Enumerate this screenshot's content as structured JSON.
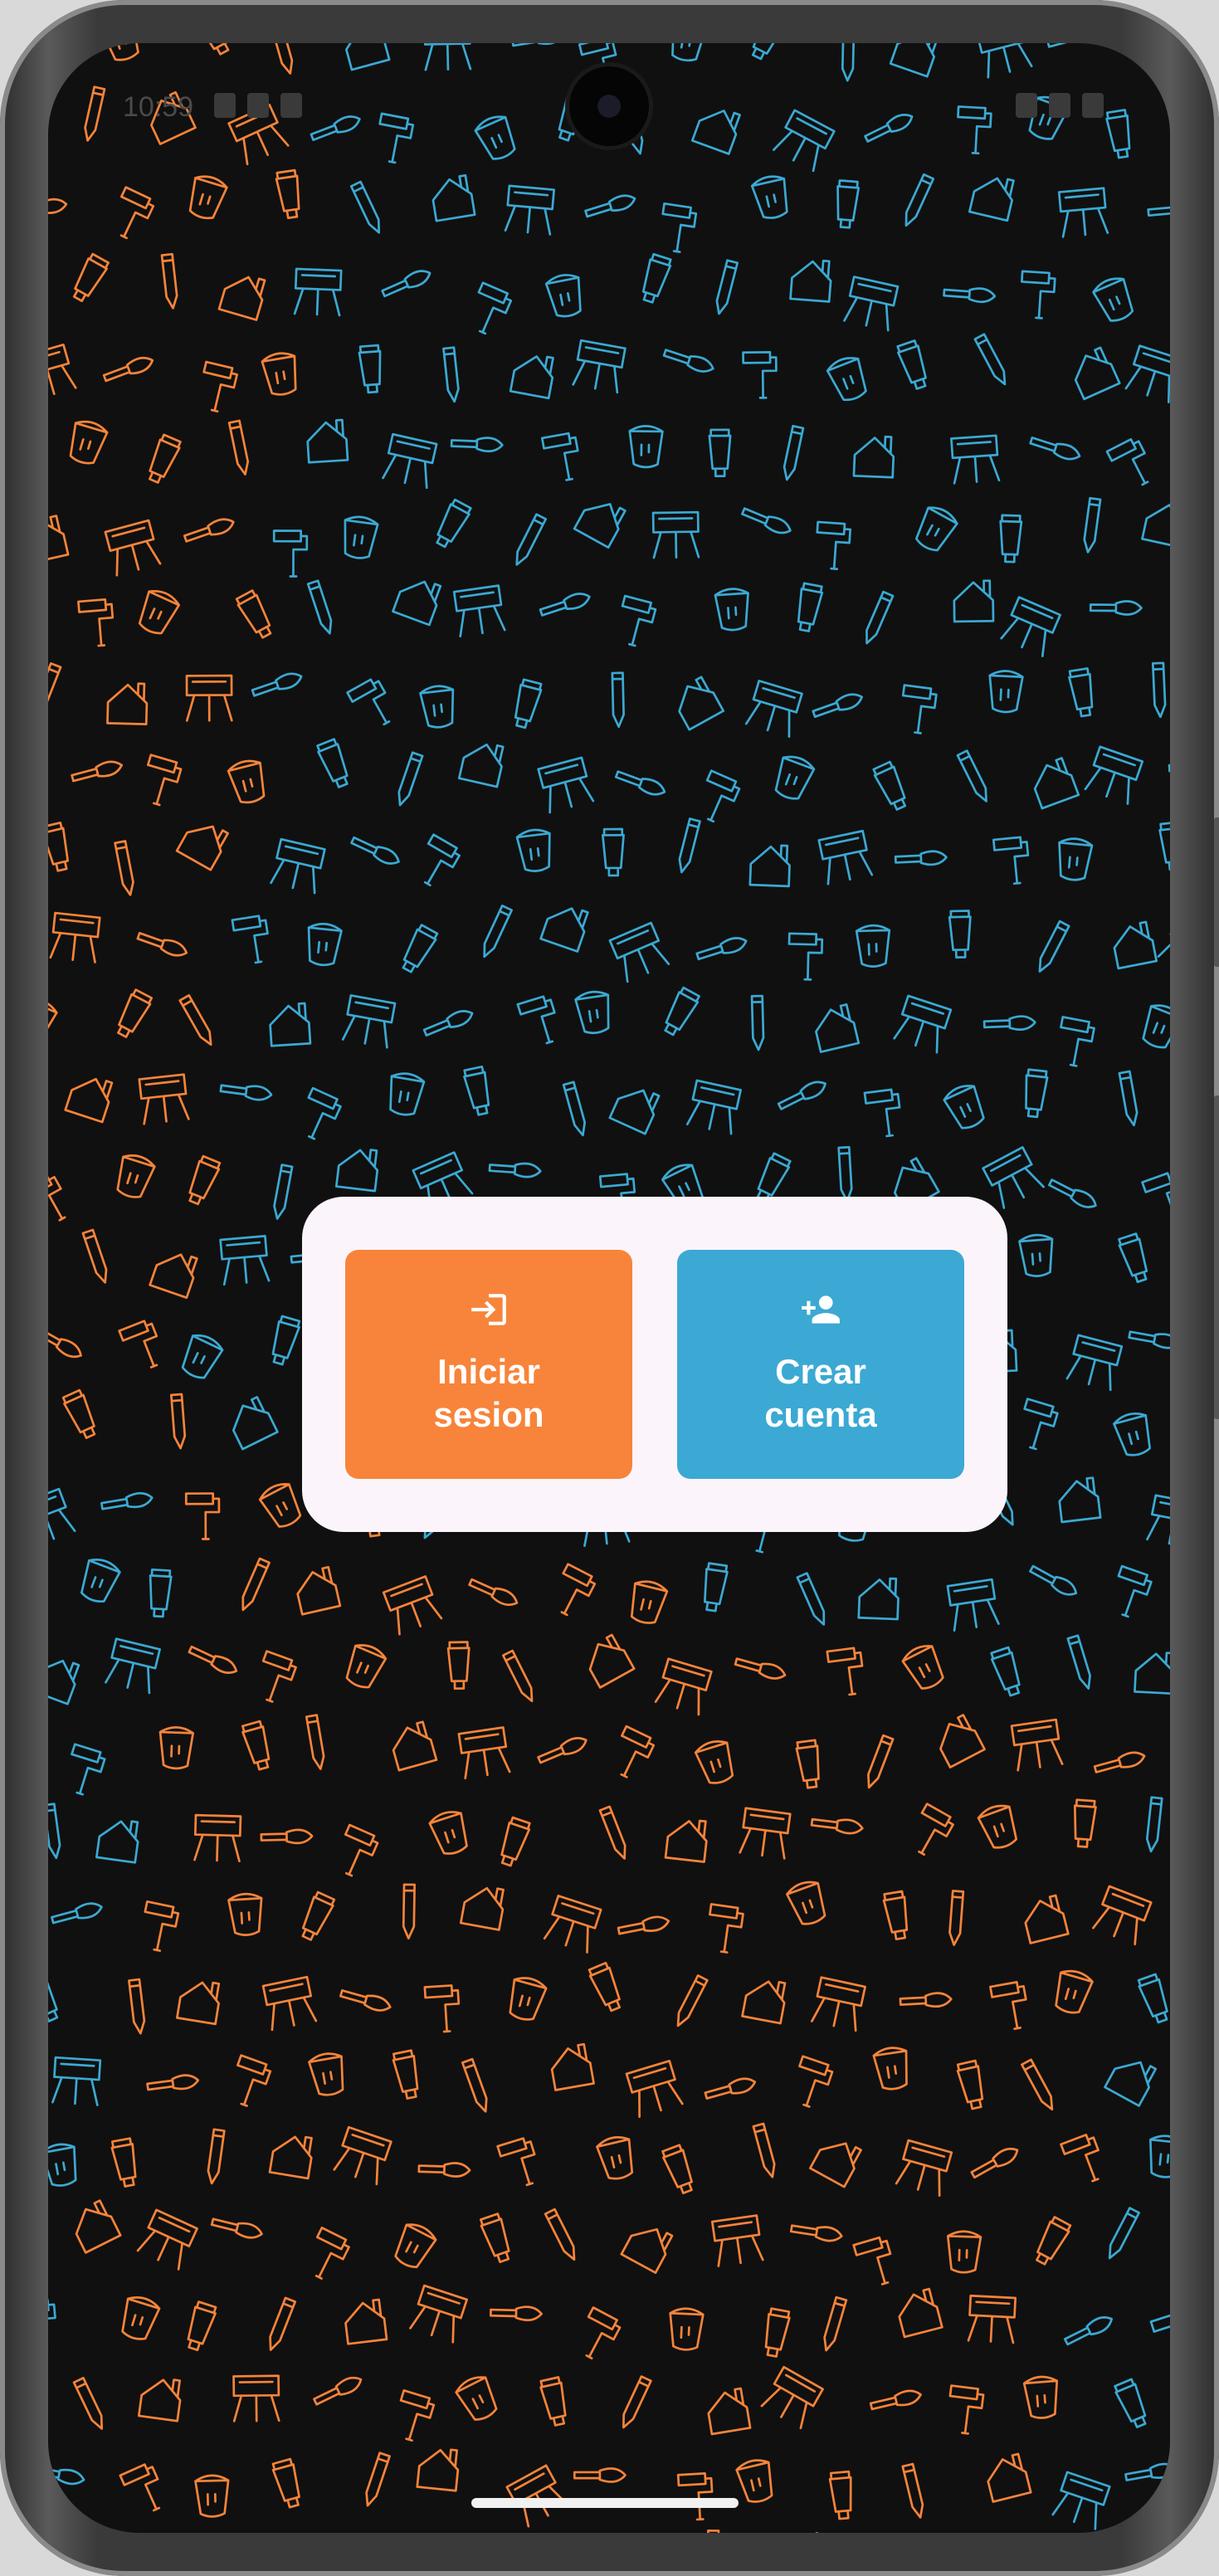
{
  "theme": {
    "accent_orange": "#f7843a",
    "accent_blue": "#3ba9d3",
    "card_background": "#fbf4fb",
    "screen_background": "#101010"
  },
  "status_bar": {
    "time": "10:59"
  },
  "auth_card": {
    "login_button": {
      "label": "Iniciar\nsesion",
      "icon": "login-icon"
    },
    "register_button": {
      "label": "Crear\ncuenta",
      "icon": "person-add-icon"
    }
  },
  "background_pattern": {
    "icons": [
      "paint-roller-icon",
      "paint-bucket-icon",
      "paint-tube-icon",
      "pencil-icon",
      "house-icon",
      "easel-icon",
      "paintbrush-icon"
    ]
  }
}
